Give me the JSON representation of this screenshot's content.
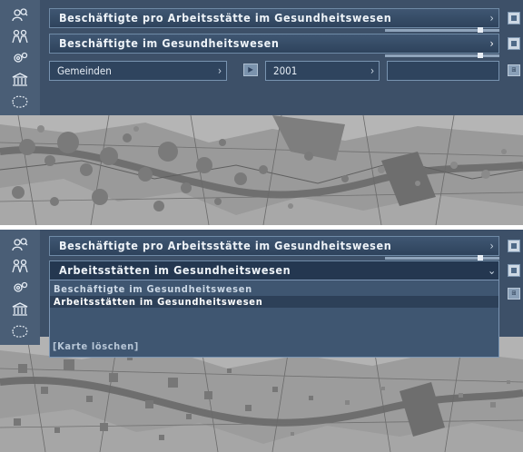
{
  "top_view": {
    "indicator_label": "Beschäftigte pro Arbeitsstätte im Gesundheitswesen",
    "variable_label": "Beschäftigte im Gesundheitswesen",
    "level_label": "Gemeinden",
    "year_value": "2001"
  },
  "bottom_view": {
    "indicator_label": "Beschäftigte pro Arbeitsstätte im Gesundheitswesen",
    "variable_label": "Arbeitsstätten im Gesundheitswesen",
    "dropdown_options": [
      "Beschäftigte im Gesundheitswesen",
      "Arbeitsstätten im Gesundheitswesen"
    ],
    "clear_map_label": "[Karte löschen]"
  },
  "sidebar_icons": [
    "people-search-icon",
    "population-icon",
    "gears-icon",
    "institution-icon",
    "map-outline-icon"
  ],
  "colors": {
    "panel": "#3d5068",
    "bar": "#2e435c",
    "accent": "#e8eef5",
    "map_gray": "#8d8d8d"
  }
}
